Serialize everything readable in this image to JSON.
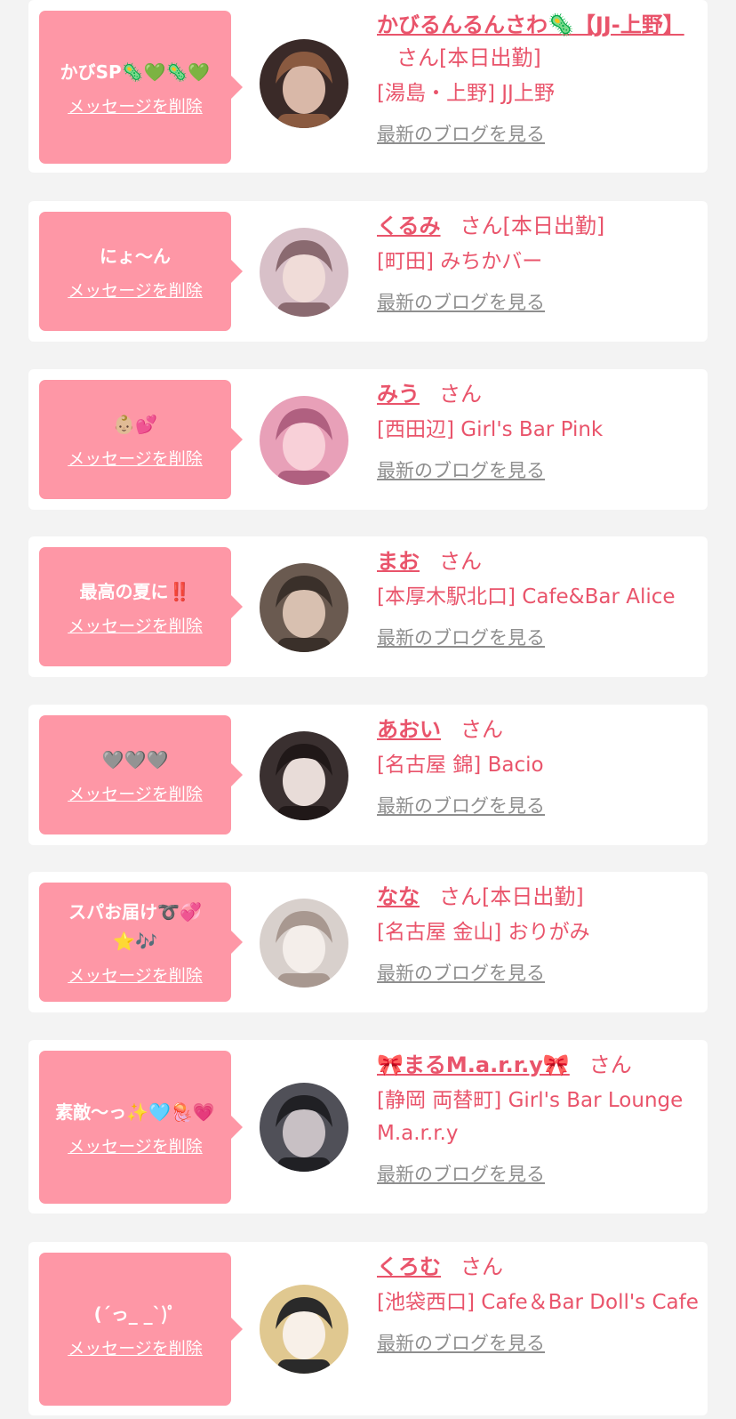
{
  "delete_label": "メッセージを削除",
  "blog_label": "最新のブログを見る",
  "colors": {
    "bubble": "#fe97a6",
    "accent": "#e9546b",
    "link_gray": "#8e8e8e",
    "background": "#f3f3f3"
  },
  "items": [
    {
      "message": "かびSP🦠💚🦠💚",
      "name": "かびるんるんさわ🦠【JJ-上野】",
      "suffix": "さん[本日出勤]",
      "shop": "[湯島・上野] JJ上野",
      "avatar_icon": "avatar-photo"
    },
    {
      "message": "にょ〜ん",
      "name": "くるみ",
      "suffix": "さん[本日出勤]",
      "shop": "[町田] みちかバー",
      "avatar_icon": "avatar-photo"
    },
    {
      "message": "👶🏼💕",
      "name": "みう",
      "suffix": "さん",
      "shop": "[西田辺] Girl's Bar Pink",
      "avatar_icon": "avatar-photo"
    },
    {
      "message": "最高の夏に‼️",
      "name": "まお",
      "suffix": "さん",
      "shop": "[本厚木駅北口] Cafe&Bar Alice",
      "avatar_icon": "avatar-photo"
    },
    {
      "message": "🩶🩶🩶",
      "name": "あおい",
      "suffix": "さん",
      "shop": "[名古屋 錦] Bacio",
      "avatar_icon": "avatar-photo"
    },
    {
      "message": "スパお届け➰💞⭐️🎶",
      "name": "なな",
      "suffix": "さん[本日出勤]",
      "shop": "[名古屋 金山] おりがみ",
      "avatar_icon": "avatar-photo"
    },
    {
      "message": "素敵〜っ✨🩵🪼💗",
      "name": "🎀まるM.a.r.r.y🎀",
      "suffix": "さん",
      "shop": "[静岡 両替町] Girl's Bar Lounge M.a.r.r.y",
      "avatar_icon": "avatar-photo"
    },
    {
      "message": "(´っ_ _`)ﾟ",
      "name": "くろむ",
      "suffix": "さん",
      "shop": "[池袋西口] Cafe＆Bar Doll's Cafe",
      "avatar_icon": "avatar-photo"
    }
  ]
}
